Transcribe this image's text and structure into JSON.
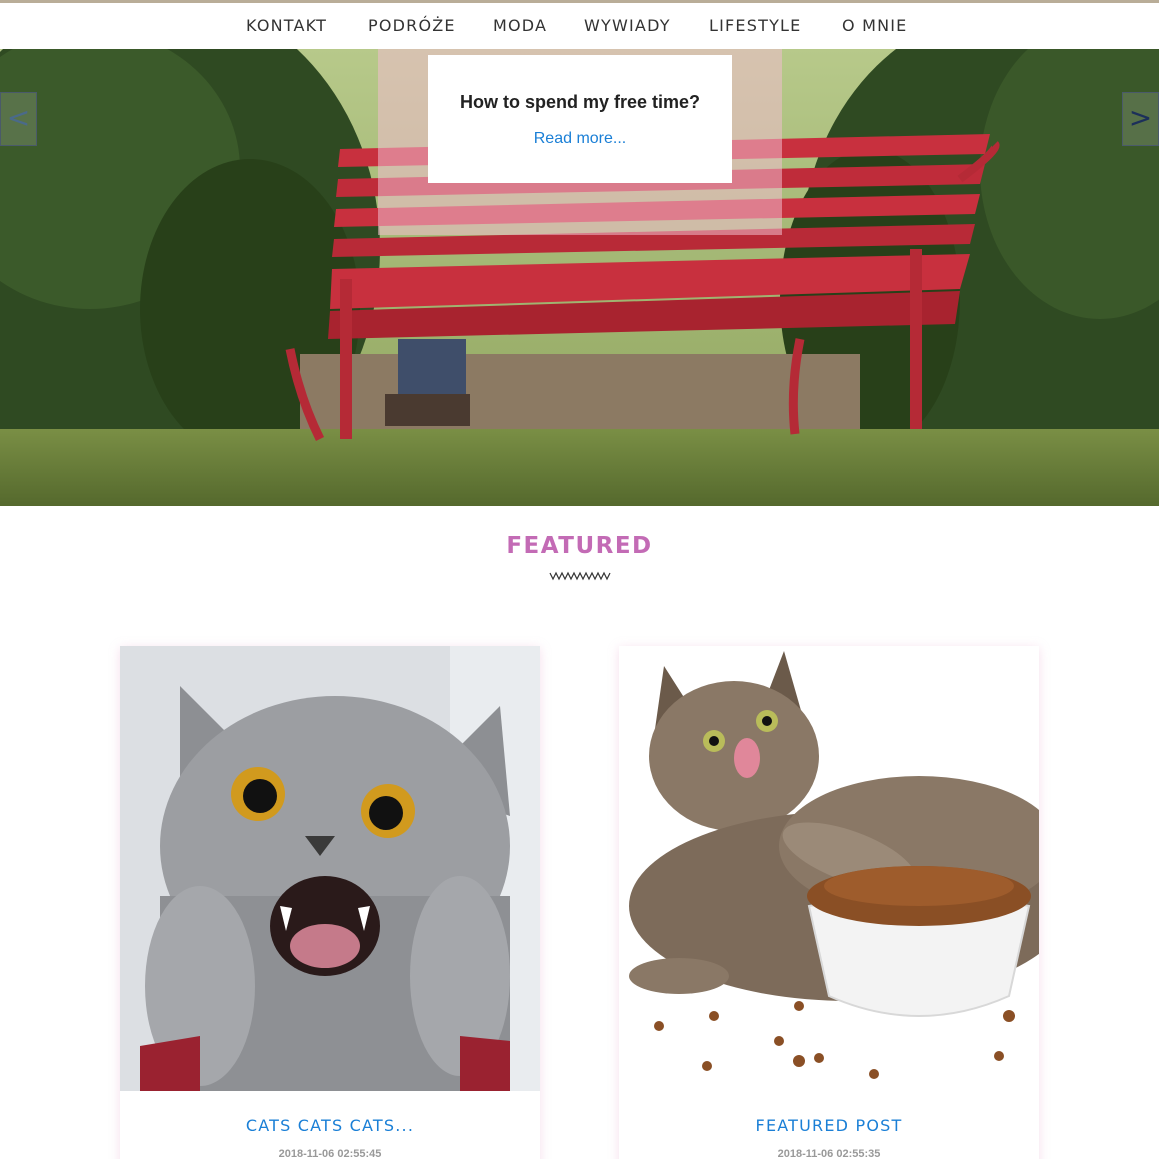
{
  "nav": {
    "items": [
      {
        "label": "KONTAKT"
      },
      {
        "label": "PODRÓŻE"
      },
      {
        "label": "MODA"
      },
      {
        "label": "WYWIADY"
      },
      {
        "label": "LIFESTYLE"
      },
      {
        "label": "O MNIE"
      }
    ]
  },
  "hero": {
    "title": "How to spend my free time?",
    "link": "Read more...",
    "prev": "<",
    "next": ">"
  },
  "featured": {
    "heading": "FEATURED",
    "posts": [
      {
        "title": "CATS CATS CATS...",
        "date": "2018-11-06 02:55:45"
      },
      {
        "title": "FEATURED POST",
        "date": "2018-11-06 02:55:35"
      }
    ]
  },
  "colors": {
    "accent_pink": "#c36bb5",
    "link_blue": "#1a7fd6",
    "bench_red": "#c8303e"
  }
}
